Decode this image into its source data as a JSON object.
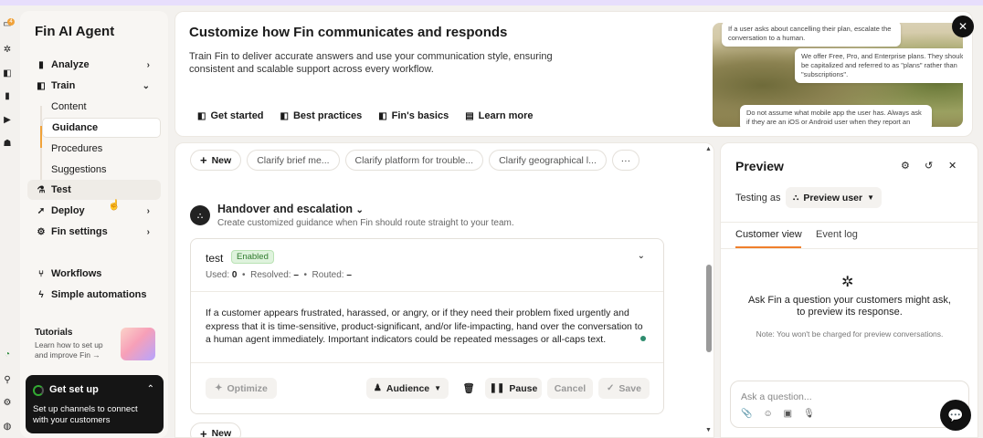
{
  "rail": {
    "badge": "4",
    "icons": [
      "inbox-icon",
      "fin-icon",
      "book-icon",
      "bar-chart-icon",
      "send-icon",
      "contacts-icon",
      "green-dot-icon",
      "search-icon",
      "settings-icon",
      "status-icon"
    ]
  },
  "sidebar": {
    "title": "Fin AI Agent",
    "items": [
      {
        "label": "Analyze",
        "icon": "bar-chart-icon",
        "chevron": "›"
      },
      {
        "label": "Train",
        "icon": "book-icon",
        "chevron": "⌄"
      },
      {
        "label": "Test",
        "icon": "flask-icon"
      },
      {
        "label": "Deploy",
        "icon": "rocket-icon",
        "chevron": "›"
      },
      {
        "label": "Fin settings",
        "icon": "gear-icon",
        "chevron": "›"
      },
      {
        "label": "Workflows",
        "icon": "workflow-icon"
      },
      {
        "label": "Simple automations",
        "icon": "bolt-icon"
      }
    ],
    "train_sub": [
      "Content",
      "Guidance",
      "Procedures",
      "Suggestions"
    ],
    "active_sub": "Guidance",
    "tutorials": {
      "title": "Tutorials",
      "desc": "Learn how to set up and improve Fin →"
    },
    "setup": {
      "title": "Get set up",
      "desc": "Set up channels to connect with your customers",
      "chevron": "⌃"
    }
  },
  "hero": {
    "title": "Customize how Fin communicates and responds",
    "desc": "Train Fin to deliver accurate answers and use your communication style, ensuring consistent and scalable support across every workflow.",
    "links": [
      "Get started",
      "Best practices",
      "Fin's basics",
      "Learn more"
    ],
    "art_bubbles": [
      "If a user asks about cancelling their plan, escalate the conversation to a human.",
      "We offer Free, Pro, and Enterprise plans. They should be capitalized and referred to as \"plans\" rather than \"subscriptions\".",
      "Do not assume what mobile app the user has. Always ask if they are an iOS or Android user when they report an"
    ],
    "close": "✕"
  },
  "guidance": {
    "new_label": "New",
    "chips": [
      "Clarify brief me...",
      "Clarify platform for trouble...",
      "Clarify geographical l..."
    ],
    "more": "···",
    "section": {
      "title": "Handover and escalation",
      "desc": "Create customized guidance when Fin should route straight to your team."
    },
    "card": {
      "name": "test",
      "status": "Enabled",
      "used_label": "Used:",
      "used": "0",
      "resolved_label": "Resolved:",
      "resolved": "–",
      "routed_label": "Routed:",
      "routed": "–",
      "body": "If a customer appears frustrated, harassed, or angry, or if they need their problem fixed urgently and express that it is time-sensitive, product-significant, and/or life-impacting, hand over the conversation to a human agent immediately. Important indicators could be repeated messages or all-caps text.",
      "optimize": "Optimize",
      "audience": "Audience",
      "pause": "Pause",
      "cancel": "Cancel",
      "save": "Save"
    },
    "new_bottom": "New"
  },
  "preview": {
    "title": "Preview",
    "testing_as": "Testing as",
    "user": "Preview user",
    "tabs": [
      "Customer view",
      "Event log"
    ],
    "ask": "Ask Fin a question your customers might ask, to preview its response.",
    "note": "Note: You won't be charged for preview conversations.",
    "input_placeholder": "Ask a question..."
  },
  "colors": {
    "accent": "#f07f2c",
    "enabled_bg": "#dff3dd",
    "enabled_text": "#2f7a2d",
    "dark": "#151515"
  }
}
